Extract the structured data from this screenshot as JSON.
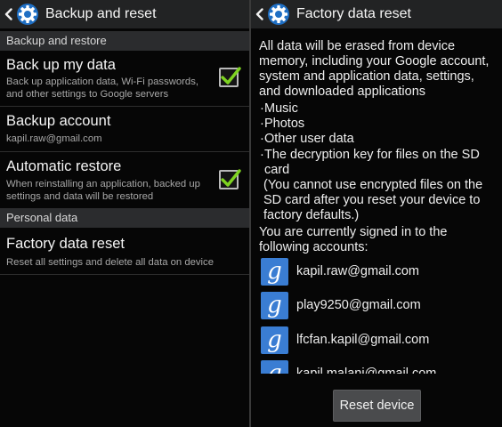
{
  "left": {
    "title": "Backup and reset",
    "sections": {
      "backup_restore": "Backup and restore",
      "personal_data": "Personal data"
    },
    "backup_my_data": {
      "title": "Back up my data",
      "subtitle_line1": "Back up application data, Wi-Fi passwords,",
      "subtitle_line2": "and other settings to Google servers",
      "checked": true
    },
    "backup_account": {
      "title": "Backup account",
      "subtitle": "kapil.raw@gmail.com"
    },
    "automatic_restore": {
      "title": "Automatic restore",
      "subtitle_line1": "When reinstalling an application, backed up",
      "subtitle_line2": "settings and data will be restored",
      "checked": true
    },
    "factory_reset": {
      "title": "Factory data reset",
      "subtitle": "Reset all settings and delete all data on device"
    }
  },
  "right": {
    "title": "Factory data reset",
    "warning_lines": [
      "All data will be erased from device",
      "memory, including your Google account,",
      "system and application data, settings,",
      "and downloaded applications"
    ],
    "bullets": [
      "Music",
      "Photos",
      "Other user data",
      "The decryption key for files on the SD"
    ],
    "bullet_continuation": "card",
    "sd_note_lines": [
      "(You cannot use encrypted files on the",
      "SD card after you reset your device to",
      "factory defaults.)"
    ],
    "signed_in_lines": [
      "You are currently signed in to the",
      "following accounts:"
    ],
    "accounts": [
      "kapil.raw@gmail.com",
      "play9250@gmail.com",
      "lfcfan.kapil@gmail.com",
      "kapil.malani@gmail.com"
    ],
    "google_letter": "g",
    "reset_button": "Reset device"
  },
  "colors": {
    "check_green": "#7ed321",
    "google_blue": "#3a7dd3",
    "settings_gear_blue": "#2f8fe0"
  },
  "icons": [
    "back-chevron-icon",
    "settings-gear-icon",
    "checkmark-icon",
    "google-account-icon"
  ]
}
